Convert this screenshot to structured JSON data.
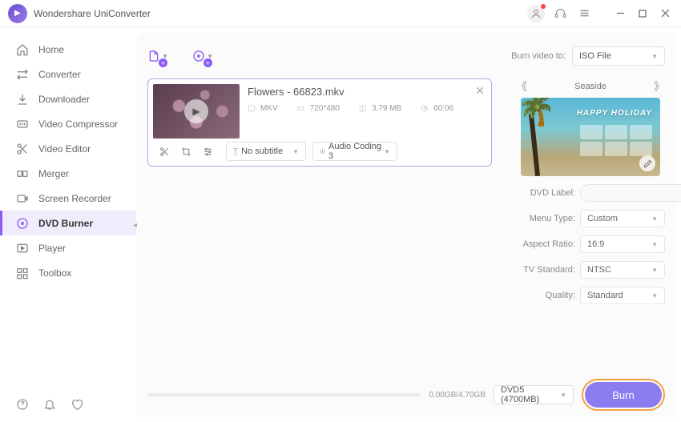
{
  "app_title": "Wondershare UniConverter",
  "sidebar": {
    "items": [
      {
        "label": "Home"
      },
      {
        "label": "Converter"
      },
      {
        "label": "Downloader"
      },
      {
        "label": "Video Compressor"
      },
      {
        "label": "Video Editor"
      },
      {
        "label": "Merger"
      },
      {
        "label": "Screen Recorder"
      },
      {
        "label": "DVD Burner"
      },
      {
        "label": "Player"
      },
      {
        "label": "Toolbox"
      }
    ]
  },
  "toolbar": {
    "burn_to_label": "Burn video to:",
    "burn_to_value": "ISO File"
  },
  "video": {
    "title": "Flowers - 66823.mkv",
    "format": "MKV",
    "resolution": "720*480",
    "size": "3.79 MB",
    "duration": "00:06",
    "subtitle": "No subtitle",
    "audio": "Audio Coding 3"
  },
  "template": {
    "name": "Seaside",
    "title": "HAPPY HOLIDAY"
  },
  "form": {
    "dvd_label_label": "DVD Label:",
    "dvd_label_value": "",
    "menu_type_label": "Menu Type:",
    "menu_type_value": "Custom",
    "aspect_label": "Aspect Ratio:",
    "aspect_value": "16:9",
    "tv_label": "TV Standard:",
    "tv_value": "NTSC",
    "quality_label": "Quality:",
    "quality_value": "Standard"
  },
  "bottom": {
    "size_text": "0.00GB/4.70GB",
    "disc_value": "DVD5 (4700MB)",
    "burn_label": "Burn"
  }
}
